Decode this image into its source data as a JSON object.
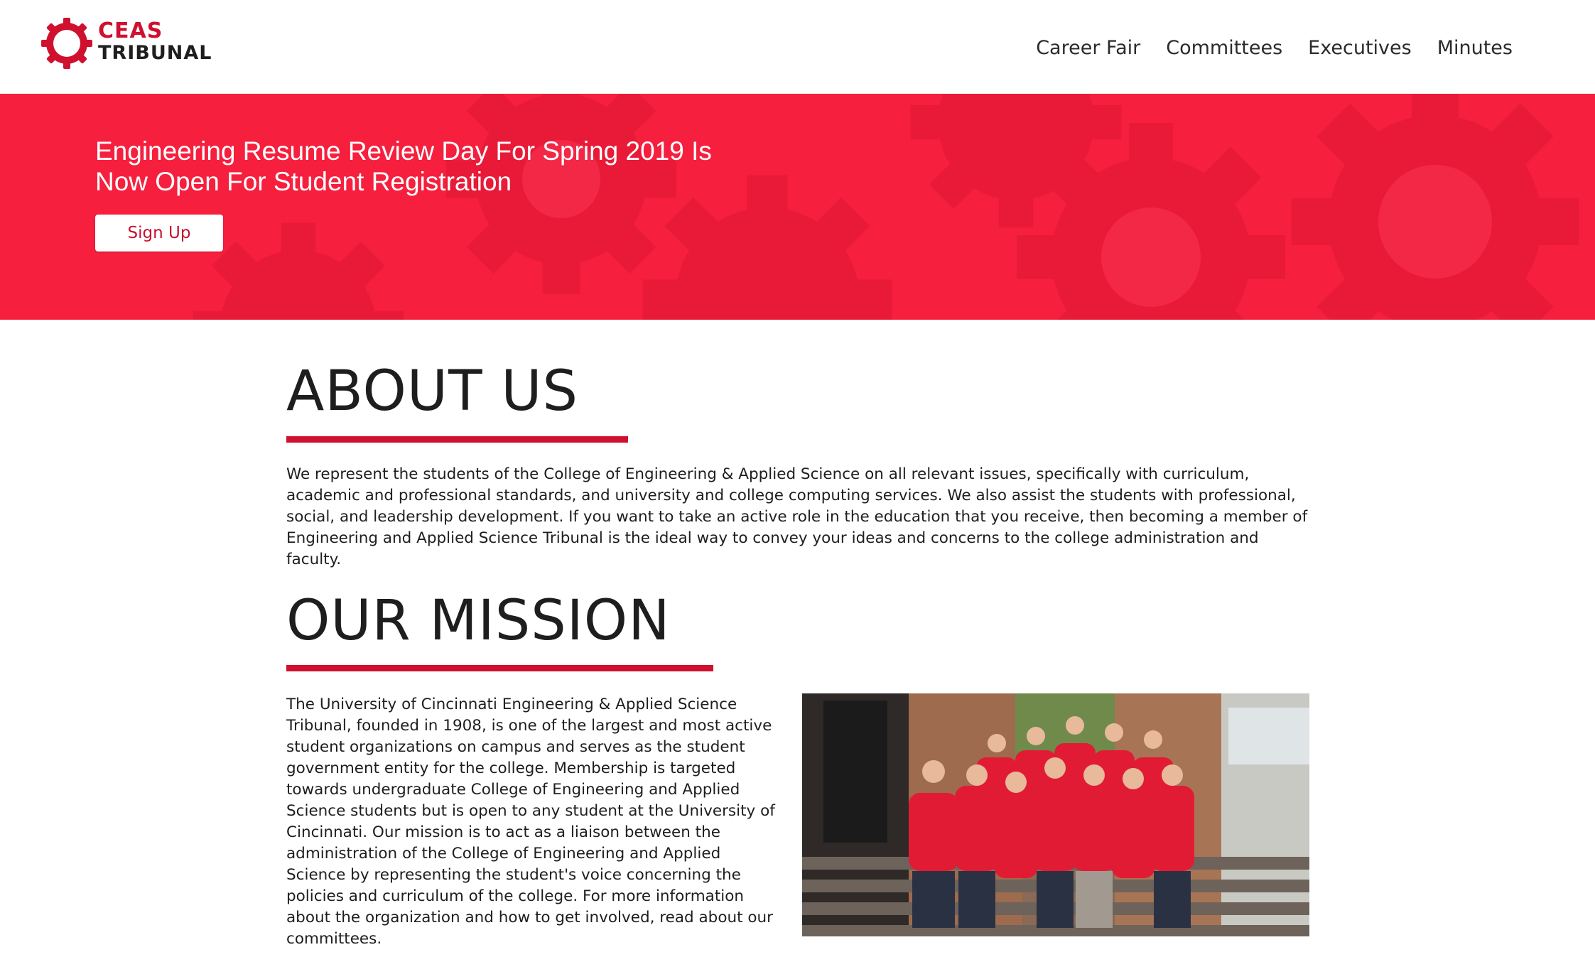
{
  "logo": {
    "line1": "CEAS",
    "line2": "TRIBUNAL"
  },
  "nav": [
    "Career Fair",
    "Committees",
    "Executives",
    "Minutes"
  ],
  "hero": {
    "title": "Engineering Resume Review Day For Spring 2019 Is Now Open For Student Registration",
    "button": "Sign Up"
  },
  "about": {
    "heading": "ABOUT US",
    "text": "We represent the students of the College of Engineering & Applied Science on all relevant issues, specifically with curriculum, academic and professional standards, and university and college computing services. We also assist the students with professional, social, and leadership development. If you want to take an active role in the education that you receive, then becoming a member of Engineering and Applied Science Tribunal is the ideal way to convey your ideas and concerns to the college administration and faculty."
  },
  "mission": {
    "heading": "OUR MISSION",
    "text": "The University of Cincinnati Engineering & Applied Science Tribunal, founded in 1908, is one of the largest and most active student organizations on campus and serves as the student government entity for the college. Membership is targeted towards undergraduate College of Engineering and Applied Science students but is open to any student at the University of Cincinnati. Our mission is to act as a liaison between the administration of the College of Engineering and Applied Science by representing the student's voice concerning the policies and curriculum of the college. For more information about the organization and how to get involved, read about our committees."
  },
  "colors": {
    "accent": "#d0102f",
    "hero_bg": "#f61f3e"
  }
}
